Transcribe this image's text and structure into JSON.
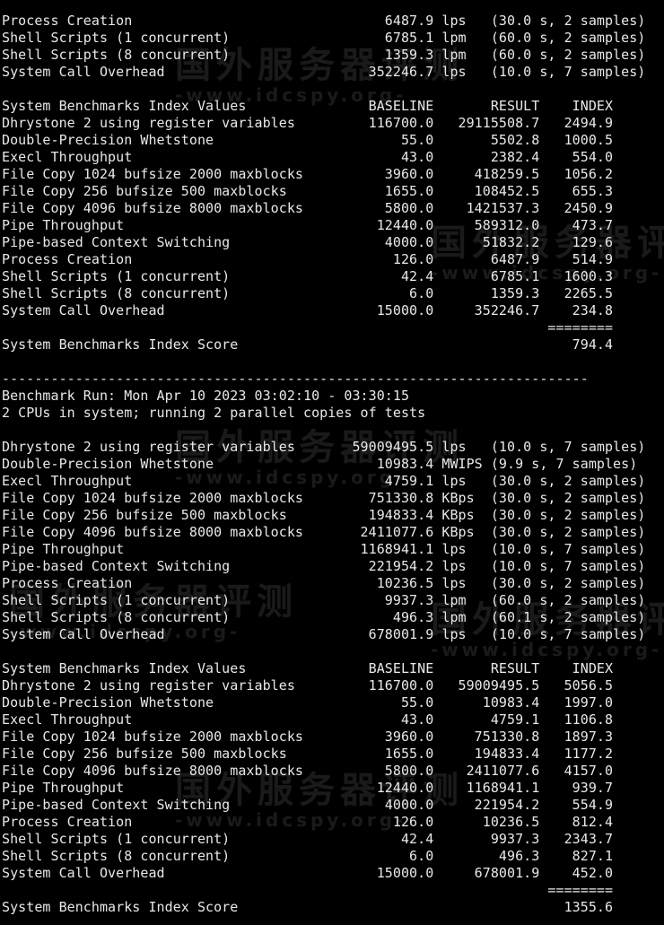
{
  "terminal": {
    "lines": [
      "Process Creation                               6487.9 lps   (30.0 s, 2 samples)",
      "Shell Scripts (1 concurrent)                   6785.1 lpm   (60.0 s, 2 samples)",
      "Shell Scripts (8 concurrent)                   1359.3 lpm   (60.0 s, 2 samples)",
      "System Call Overhead                         352246.7 lps   (10.0 s, 7 samples)",
      "",
      "System Benchmarks Index Values               BASELINE       RESULT    INDEX",
      "Dhrystone 2 using register variables         116700.0   29115508.7   2494.9",
      "Double-Precision Whetstone                       55.0       5502.8   1000.5",
      "Execl Throughput                                 43.0       2382.4    554.0",
      "File Copy 1024 bufsize 2000 maxblocks          3960.0     418259.5   1056.2",
      "File Copy 256 bufsize 500 maxblocks            1655.0     108452.5    655.3",
      "File Copy 4096 bufsize 8000 maxblocks          5800.0    1421537.3   2450.9",
      "Pipe Throughput                               12440.0     589312.0    473.7",
      "Pipe-based Context Switching                   4000.0      51832.2    129.6",
      "Process Creation                                126.0       6487.9    514.9",
      "Shell Scripts (1 concurrent)                     42.4       6785.1   1600.3",
      "Shell Scripts (8 concurrent)                      6.0       1359.3   2265.5",
      "System Call Overhead                          15000.0     352246.7    234.8",
      "                                                                   ========",
      "System Benchmarks Index Score                                         794.4",
      "",
      "------------------------------------------------------------------------",
      "Benchmark Run: Mon Apr 10 2023 03:02:10 - 03:30:15",
      "2 CPUs in system; running 2 parallel copies of tests",
      "",
      "Dhrystone 2 using register variables       59009495.5 lps   (10.0 s, 7 samples)",
      "Double-Precision Whetstone                    10983.4 MWIPS (9.9 s, 7 samples)",
      "Execl Throughput                               4759.1 lps   (30.0 s, 2 samples)",
      "File Copy 1024 bufsize 2000 maxblocks        751330.8 KBps  (30.0 s, 2 samples)",
      "File Copy 256 bufsize 500 maxblocks          194833.4 KBps  (30.0 s, 2 samples)",
      "File Copy 4096 bufsize 8000 maxblocks       2411077.6 KBps  (30.0 s, 2 samples)",
      "Pipe Throughput                             1168941.1 lps   (10.0 s, 7 samples)",
      "Pipe-based Context Switching                 221954.2 lps   (10.0 s, 7 samples)",
      "Process Creation                              10236.5 lps   (30.0 s, 2 samples)",
      "Shell Scripts (1 concurrent)                   9937.3 lpm   (60.0 s, 2 samples)",
      "Shell Scripts (8 concurrent)                    496.3 lpm   (60.1 s, 2 samples)",
      "System Call Overhead                         678001.9 lps   (10.0 s, 7 samples)",
      "",
      "System Benchmarks Index Values               BASELINE       RESULT    INDEX",
      "Dhrystone 2 using register variables         116700.0   59009495.5   5056.5",
      "Double-Precision Whetstone                       55.0      10983.4   1997.0",
      "Execl Throughput                                 43.0       4759.1   1106.8",
      "File Copy 1024 bufsize 2000 maxblocks          3960.0     751330.8   1897.3",
      "File Copy 256 bufsize 500 maxblocks            1655.0     194833.4   1177.2",
      "File Copy 4096 bufsize 8000 maxblocks          5800.0    2411077.6   4157.0",
      "Pipe Throughput                               12440.0    1168941.1    939.7",
      "Pipe-based Context Switching                   4000.0     221954.2    554.9",
      "Process Creation                                126.0      10236.5    812.4",
      "Shell Scripts (1 concurrent)                     42.4       9937.3   2343.7",
      "Shell Scripts (8 concurrent)                      6.0        496.3    827.1",
      "System Call Overhead                          15000.0     678001.9    452.0",
      "                                                                   ========",
      "System Benchmarks Index Score                                        1355.6"
    ]
  },
  "watermark": {
    "text": "国外服务器评测",
    "url": "-www.idcspy.org-"
  }
}
